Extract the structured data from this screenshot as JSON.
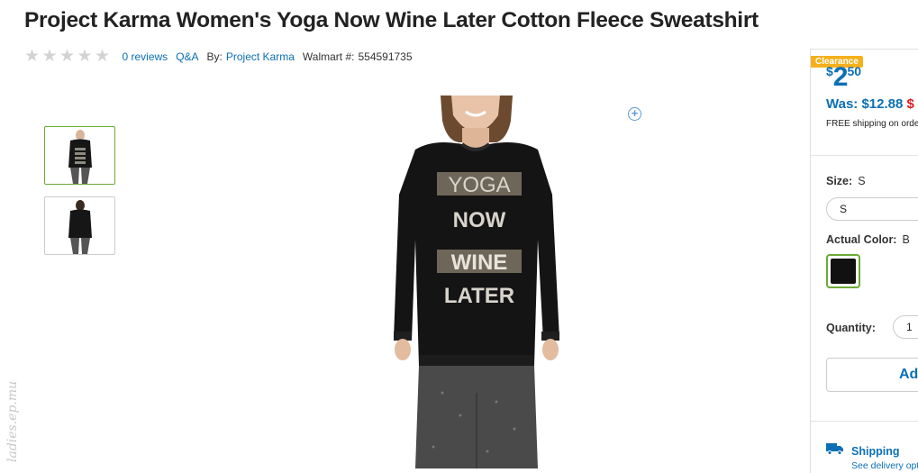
{
  "product": {
    "title": "Project Karma Women's Yoga Now Wine Later Cotton Fleece Sweatshirt",
    "reviews_link": "0 reviews",
    "qa_link": "Q&A",
    "by_label": "By:",
    "brand": "Project Karma",
    "walmart_number_label": "Walmart #:",
    "walmart_number": "554591735",
    "rating": 0,
    "max_rating": 5,
    "shirt_text": [
      "YOGA",
      "NOW",
      "WINE",
      "LATER"
    ]
  },
  "watermark": "ladies.ep.mu",
  "price_panel": {
    "badge": "Clearance",
    "price_symbol": "$",
    "price_dollars": "2",
    "price_cents": "50",
    "was_label": "Was: $12.88",
    "was_extra": "$",
    "free_shipping": "FREE shipping on orde",
    "size_label": "Size:",
    "size_value": "S",
    "size_select": "S",
    "color_label": "Actual Color:",
    "color_value": "B",
    "swatch_color": "#111111",
    "quantity_label": "Quantity:",
    "quantity_value": "1",
    "add_button": "Ad",
    "shipping_title": "Shipping",
    "shipping_sub": "See delivery opti"
  },
  "colors": {
    "link": "#0b6fb5",
    "accent_green": "#6aab36",
    "badge": "#f5b01b",
    "sale_red": "#de1c24"
  }
}
